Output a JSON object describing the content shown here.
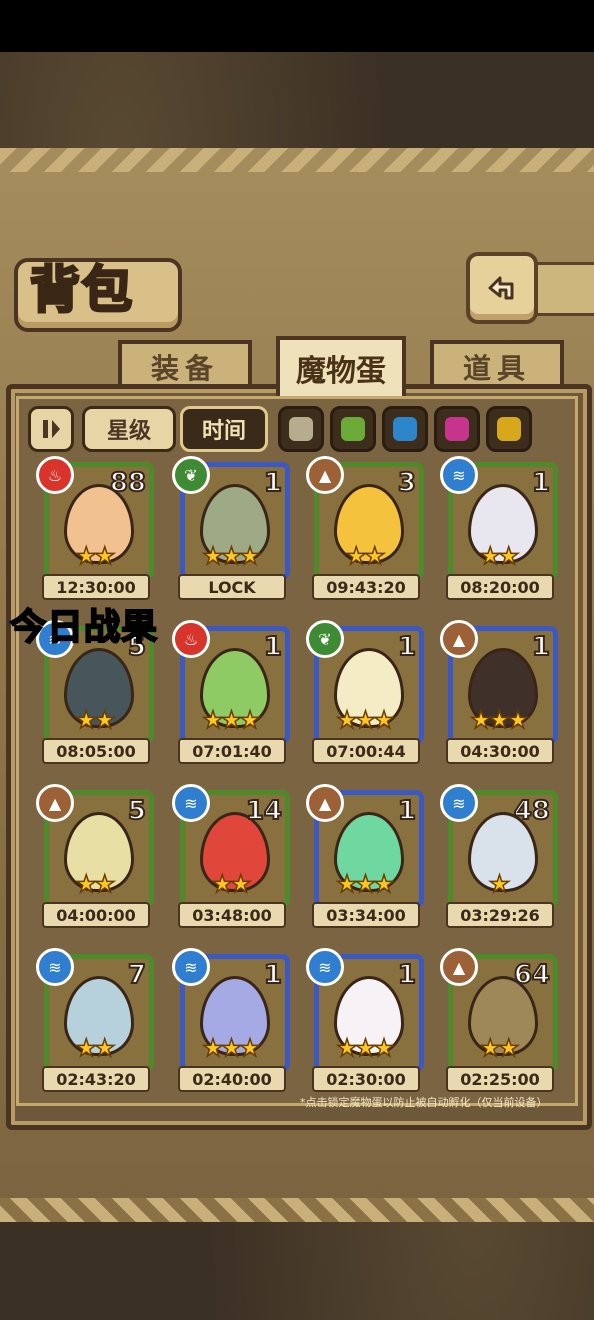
{
  "title": "背包",
  "tabs": [
    {
      "label": "装备",
      "active": false
    },
    {
      "label": "魔物蛋",
      "active": true
    },
    {
      "label": "道具",
      "active": false
    }
  ],
  "filters": {
    "sort_star": "星级",
    "sort_time": "时间",
    "active": "时间",
    "color_swatches": [
      "#b5ad8d",
      "#6cab37",
      "#2c86c9",
      "#c6348e",
      "#d7a71c"
    ]
  },
  "overlay": "今日战果",
  "hint": "*点击锁定魔物蛋以防止被自动孵化（仅当前设备）",
  "elements": {
    "fire": "#d8342c",
    "grass": "#3e8b34",
    "earth": "#9d6137",
    "water": "#2f7ed0"
  },
  "eggs": [
    {
      "element": "fire",
      "count": "88",
      "stars": "★★",
      "time": "12:30:00",
      "frame": "green",
      "color": "#f1c18f"
    },
    {
      "element": "grass",
      "count": "1",
      "stars": "★★★",
      "time": "LOCK",
      "frame": "blue",
      "color": "#9ea985"
    },
    {
      "element": "earth",
      "count": "3",
      "stars": "★★",
      "time": "09:43:20",
      "frame": "green",
      "color": "#f5c23e"
    },
    {
      "element": "water",
      "count": "1",
      "stars": "★★",
      "time": "08:20:00",
      "frame": "green",
      "color": "#e8e6ee"
    },
    {
      "element": "water",
      "count": "5",
      "stars": "★★",
      "time": "08:05:00",
      "frame": "green",
      "color": "#46565a"
    },
    {
      "element": "fire",
      "count": "1",
      "stars": "★★★",
      "time": "07:01:40",
      "frame": "blue",
      "color": "#8fcb65"
    },
    {
      "element": "grass",
      "count": "1",
      "stars": "★★★",
      "time": "07:00:44",
      "frame": "blue",
      "color": "#f4ecc4"
    },
    {
      "element": "earth",
      "count": "1",
      "stars": "★★★",
      "time": "04:30:00",
      "frame": "blue",
      "color": "#40302a"
    },
    {
      "element": "earth",
      "count": "5",
      "stars": "★★",
      "time": "04:00:00",
      "frame": "green",
      "color": "#e8dfa4"
    },
    {
      "element": "water",
      "count": "14",
      "stars": "★★",
      "time": "03:48:00",
      "frame": "green",
      "color": "#e0463a"
    },
    {
      "element": "earth",
      "count": "1",
      "stars": "★★★",
      "time": "03:34:00",
      "frame": "blue",
      "color": "#6fd7a0"
    },
    {
      "element": "water",
      "count": "48",
      "stars": "★",
      "time": "03:29:26",
      "frame": "green",
      "color": "#d9e1ea"
    },
    {
      "element": "water",
      "count": "7",
      "stars": "★★",
      "time": "02:43:20",
      "frame": "green",
      "color": "#b6d1dc"
    },
    {
      "element": "water",
      "count": "1",
      "stars": "★★★",
      "time": "02:40:00",
      "frame": "blue",
      "color": "#a5a9e4"
    },
    {
      "element": "water",
      "count": "1",
      "stars": "★★★",
      "time": "02:30:00",
      "frame": "blue",
      "color": "#f6f2f5"
    },
    {
      "element": "earth",
      "count": "64",
      "stars": "★★",
      "time": "02:25:00",
      "frame": "green",
      "color": "#9f8858"
    }
  ]
}
